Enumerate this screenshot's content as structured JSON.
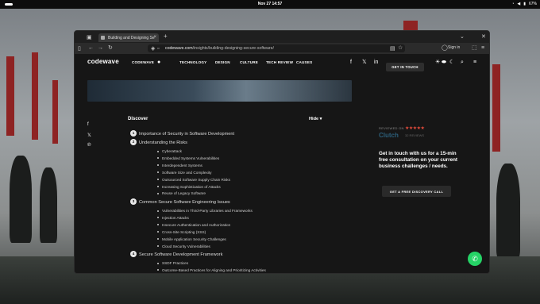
{
  "system": {
    "clock": "Nov 27  14:57",
    "battery": "67%"
  },
  "browser": {
    "tab_title": "Building and Designing Se",
    "url_host": "codewave.com",
    "url_path": "/insights/building-designing-secure-software/",
    "signin": "Sign in"
  },
  "site": {
    "logo": "codewave",
    "nav": [
      "CODEWAVE",
      "TECHNOLOGY",
      "DESIGN",
      "CULTURE",
      "TECH REVIEW",
      "CAUSES"
    ],
    "cta": "GET IN TOUCH"
  },
  "toc": {
    "title": "Discover",
    "toggle": "Hide",
    "sections": [
      {
        "num": "1",
        "title": "Importance of Security in Software Development",
        "items": []
      },
      {
        "num": "2",
        "title": "Understanding the Risks",
        "items": [
          "Cyberattack",
          "Embedded Systems Vulnerabilities",
          "Interdependent Systems",
          "Software Size and Complexity",
          "Outsourced Software Supply Chain Risks",
          "Increasing Sophistication of Attacks",
          "Reuse of Legacy Software"
        ]
      },
      {
        "num": "3",
        "title": "Common Secure Software Engineering Issues",
        "items": [
          "Vulnerabilities in Third-Party Libraries and Frameworks",
          "Injection Attacks",
          "Insecure Authentication and Authorization",
          "Cross-Site Scripting (XSS)",
          "Mobile Application Security Challenges",
          "Cloud Security Vulnerabilities"
        ]
      },
      {
        "num": "4",
        "title": "Secure Software Development Framework",
        "items": [
          "SSDF Practices",
          "Outcome-Based Practices for Aligning and Prioritizing Activities"
        ]
      }
    ]
  },
  "sidebar": {
    "reviewed_on": "REVIEWED ON",
    "stars": "★★★★★",
    "clutch": "Clutch",
    "reviews": "32 REVIEWS",
    "card_title": "Get in touch with us for a 15-min free consultation on your current business challenges / needs.",
    "card_button": "GET A FREE DISCOVERY CALL"
  }
}
